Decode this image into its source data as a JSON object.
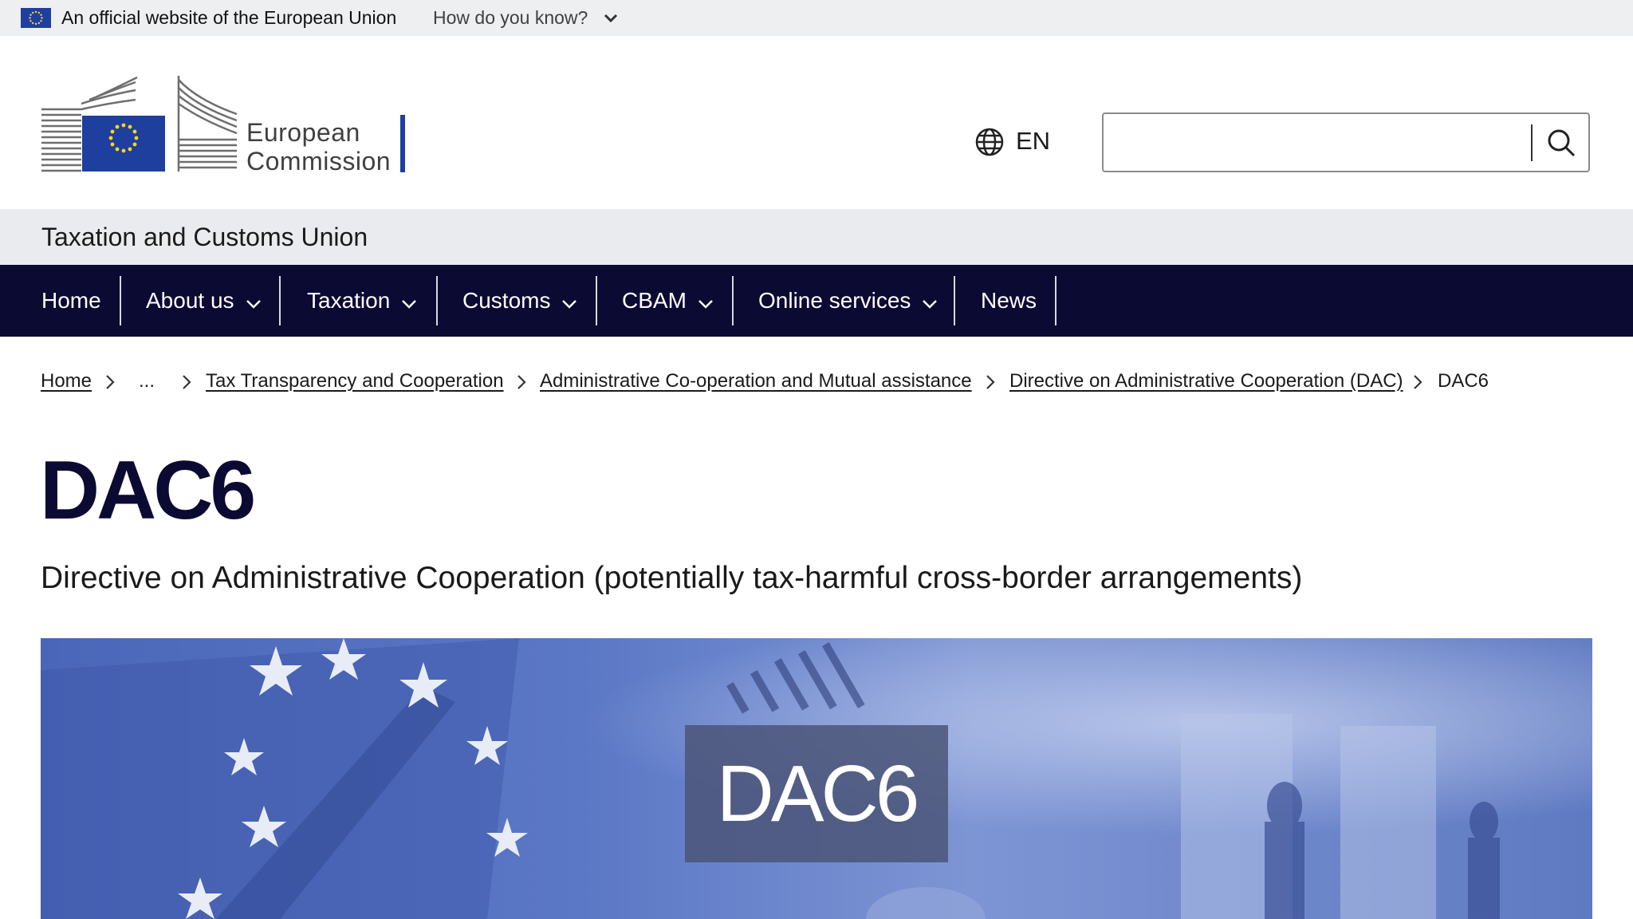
{
  "eu_banner": {
    "official_text": "An official website of the European Union",
    "how_know": "How do you know?"
  },
  "header": {
    "logo_text_line1": "European",
    "logo_text_line2": "Commission",
    "language": "EN",
    "search": {
      "value": "",
      "placeholder": ""
    }
  },
  "site_name": "Taxation and Customs Union",
  "nav": {
    "items": [
      {
        "label": "Home",
        "has_dropdown": false
      },
      {
        "label": "About us",
        "has_dropdown": true
      },
      {
        "label": "Taxation",
        "has_dropdown": true
      },
      {
        "label": "Customs",
        "has_dropdown": true
      },
      {
        "label": "CBAM",
        "has_dropdown": true
      },
      {
        "label": "Online services",
        "has_dropdown": true
      },
      {
        "label": "News",
        "has_dropdown": false
      }
    ]
  },
  "breadcrumb": {
    "items": [
      {
        "label": "Home",
        "link": true
      },
      {
        "label": "...",
        "link": false
      },
      {
        "label": "Tax Transparency and Cooperation",
        "link": true
      },
      {
        "label": "Administrative Co-operation and Mutual assistance",
        "link": true
      },
      {
        "label": "Directive on Administrative Cooperation (DAC)",
        "link": true
      },
      {
        "label": "DAC6",
        "link": false
      }
    ]
  },
  "page": {
    "title": "DAC6",
    "subtitle": "Directive on Administrative Cooperation (potentially tax-harmful cross-border arrangements)"
  },
  "hero": {
    "label": "DAC6"
  },
  "colors": {
    "nav_bg": "#0a0a33",
    "eu_blue": "#1f3f9e",
    "eu_yellow": "#ffd617",
    "title_color": "#0a0a33",
    "hero_tint": "#5a7bc8"
  },
  "icons": [
    "eu-flag-icon",
    "chevron-down-icon",
    "globe-icon",
    "search-icon",
    "chevron-right-icon"
  ]
}
